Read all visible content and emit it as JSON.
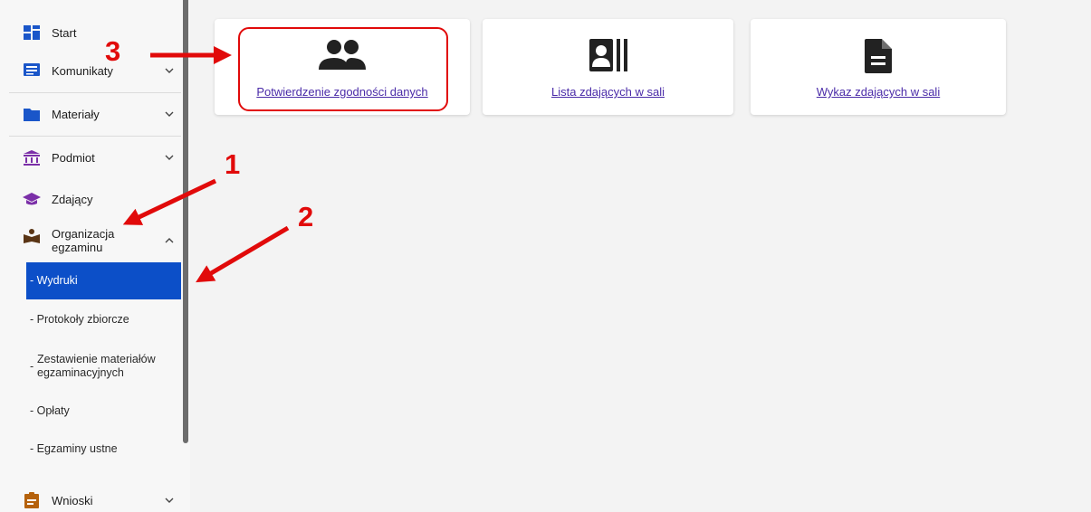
{
  "sidebar": {
    "items": [
      {
        "label": "Start",
        "icon": "dashboard-icon",
        "icon_color": "#1a56c9"
      },
      {
        "label": "Komunikaty",
        "icon": "message-icon",
        "icon_color": "#1a56c9"
      },
      {
        "label": "Materiały",
        "icon": "folder-icon",
        "icon_color": "#1a56c9"
      },
      {
        "label": "Podmiot",
        "icon": "institution-icon",
        "icon_color": "#7b2fa8"
      },
      {
        "label": "Zdający",
        "icon": "graduation-cap-icon",
        "icon_color": "#7b2fa8"
      },
      {
        "label": "Organizacja egzaminu",
        "icon": "exam-organization-icon",
        "icon_color": "#5a3515"
      },
      {
        "label": "Wnioski",
        "icon": "clipboard-icon",
        "icon_color": "#b5620c"
      }
    ],
    "subitems": [
      {
        "label": "- Wydruki",
        "active": true
      },
      {
        "label": "- Protokoły zbiorcze"
      },
      {
        "dash": "-",
        "label": "Zestawienie materiałów egzaminacyjnych"
      },
      {
        "label": "- Opłaty"
      },
      {
        "label": "- Egzaminy ustne"
      }
    ],
    "active_color": "#0c4fc8"
  },
  "cards": [
    {
      "label": "Potwierdzenie zgodności danych",
      "icon": "people-icon"
    },
    {
      "label": "Lista zdających w sali",
      "icon": "contact-list-icon"
    },
    {
      "label": "Wykaz zdających w sali",
      "icon": "document-icon"
    }
  ],
  "annotations": {
    "one": "1",
    "two": "2",
    "three": "3",
    "color": "#e10a0a"
  }
}
